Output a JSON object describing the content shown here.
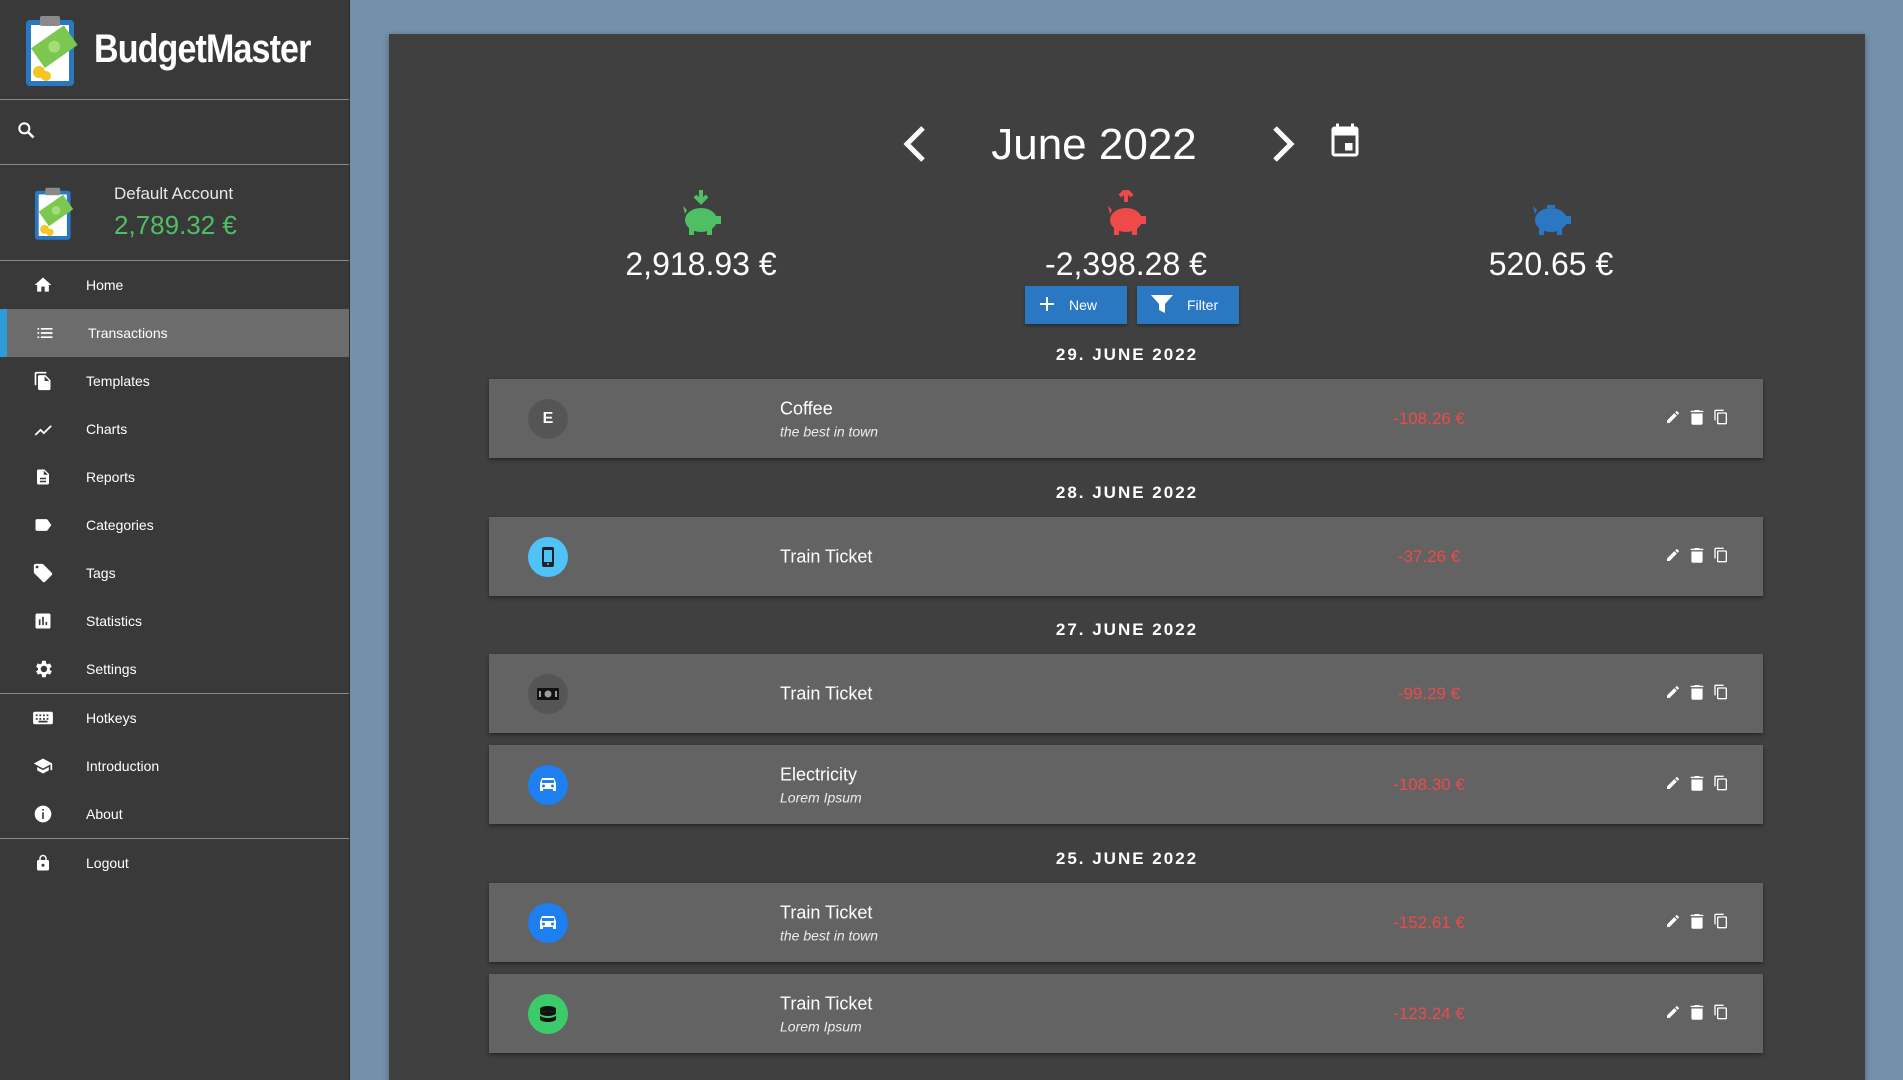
{
  "app": {
    "name": "BudgetMaster"
  },
  "search": {
    "placeholder": ""
  },
  "account": {
    "name": "Default Account",
    "balance": "2,789.32 €"
  },
  "nav": {
    "home": "Home",
    "transactions": "Transactions",
    "templates": "Templates",
    "charts": "Charts",
    "reports": "Reports",
    "categories": "Categories",
    "tags": "Tags",
    "statistics": "Statistics",
    "settings": "Settings",
    "hotkeys": "Hotkeys",
    "introduction": "Introduction",
    "about": "About",
    "logout": "Logout"
  },
  "month": {
    "title": "June 2022"
  },
  "summary": {
    "income": "2,918.93 €",
    "expenses": "-2,398.28 €",
    "total": "520.65 €",
    "colors": {
      "income": "#4fbf63",
      "expenses": "#ee4a4a",
      "total": "#2a78c2"
    }
  },
  "buttons": {
    "new": "New",
    "filter": "Filter"
  },
  "dates": [
    "29. JUNE 2022",
    "28. JUNE 2022",
    "27. JUNE 2022",
    "25. JUNE 2022"
  ],
  "transactions": [
    {
      "name": "Coffee",
      "description": "the best in town",
      "amount": "-108.26 €",
      "category_icon": "letter-e-icon",
      "category_letter": "E",
      "category_color": "#555555"
    },
    {
      "name": "Train Ticket",
      "description": "",
      "amount": "-37.26 €",
      "category_icon": "phone-icon",
      "category_color": "#4fc3f7"
    },
    {
      "name": "Train Ticket",
      "description": "",
      "amount": "-99.29 €",
      "category_icon": "money-icon",
      "category_color": "#555555"
    },
    {
      "name": "Electricity",
      "description": "Lorem Ipsum",
      "amount": "-108.30 €",
      "category_icon": "car-icon",
      "category_color": "#1e7ff0"
    },
    {
      "name": "Train Ticket",
      "description": "the best in town",
      "amount": "-152.61 €",
      "category_icon": "car-icon",
      "category_color": "#1e7ff0"
    },
    {
      "name": "Train Ticket",
      "description": "Lorem Ipsum",
      "amount": "-123.24 €",
      "category_icon": "coins-icon",
      "category_color": "#3ccb6a"
    }
  ],
  "colors": {
    "sidebar": "#393939",
    "panel": "#404040",
    "row": "#636363",
    "accent": "#2e9cdb",
    "button": "#2a78c2",
    "negative": "#ee4a4a"
  }
}
